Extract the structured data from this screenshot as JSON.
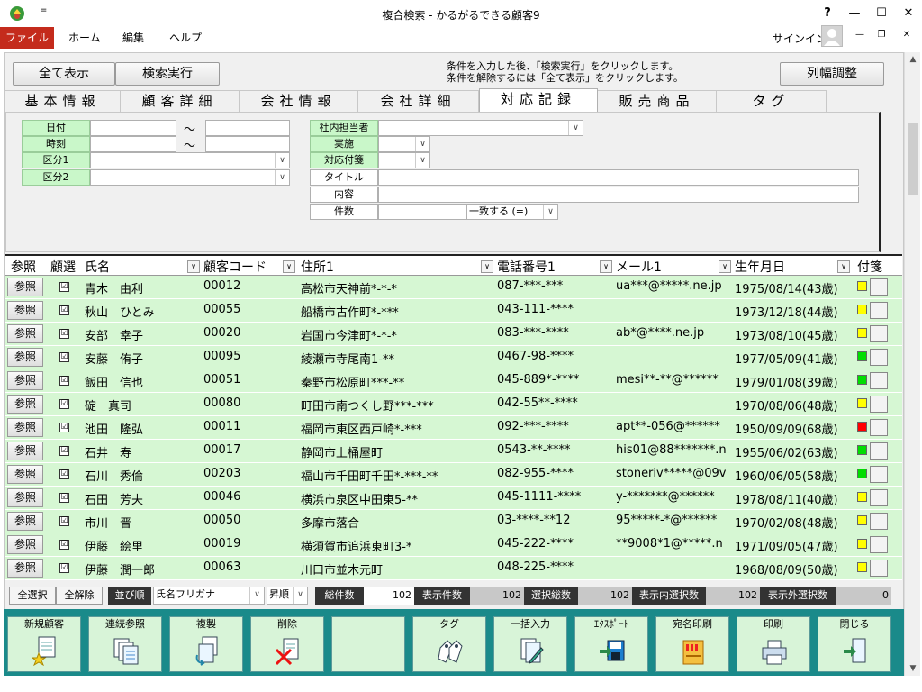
{
  "window": {
    "title": "複合検索 - かるがるできる顧客9",
    "quick_access": "=",
    "help": "?"
  },
  "menu": {
    "file": "ファイル",
    "home": "ホーム",
    "edit": "編集",
    "help": "ヘルプ",
    "signin": "サインイン"
  },
  "toolbar": {
    "show_all": "全て表示",
    "search": "検索実行",
    "hint1": "条件を入力した後、「検索実行」をクリックします。",
    "hint2": "条件を解除するには「全て表示」をクリックします。",
    "column_width": "列幅調整"
  },
  "tabs": [
    "基本情報",
    "顧客詳細",
    "会社情報",
    "会社詳細",
    "対応記録",
    "販売商品",
    "タグ"
  ],
  "active_tab": "対応記録",
  "filters": {
    "date": "日付",
    "time": "時刻",
    "kubun1": "区分1",
    "kubun2": "区分2",
    "tilde": "～",
    "staff": "社内担当者",
    "done": "実施",
    "attach": "対応付箋",
    "title": "タイトル",
    "content": "内容",
    "count": "件数",
    "match_option": "一致する (=)"
  },
  "grid": {
    "headers": {
      "ref": "参照",
      "sel": "顧選",
      "name": "氏名",
      "code": "顧客コード",
      "addr": "住所1",
      "tel": "電話番号1",
      "mail": "メール1",
      "birth": "生年月日",
      "tag": "付箋"
    },
    "ref_label": "参照",
    "check": "☑",
    "rows": [
      {
        "name": "青木　由利",
        "code": "00012",
        "addr": "高松市天神前*-*-*",
        "tel": "087-***-***",
        "mail": "ua***@*****.ne.jp",
        "birth": "1975/08/14(43歳)",
        "tag": "#ffff00"
      },
      {
        "name": "秋山　ひとみ",
        "code": "00055",
        "addr": "船橋市古作町*-***",
        "tel": "043-111-****",
        "mail": "",
        "birth": "1973/12/18(44歳)",
        "tag": "#ffff00"
      },
      {
        "name": "安部　幸子",
        "code": "00020",
        "addr": "岩国市今津町*-*-*",
        "tel": "083-***-****",
        "mail": "ab*@****.ne.jp",
        "birth": "1973/08/10(45歳)",
        "tag": "#ffff00"
      },
      {
        "name": "安藤　侑子",
        "code": "00095",
        "addr": "綾瀬市寺尾南1-**",
        "tel": "0467-98-****",
        "mail": "",
        "birth": "1977/05/09(41歳)",
        "tag": "#00dd00"
      },
      {
        "name": "飯田　信也",
        "code": "00051",
        "addr": "秦野市松原町***-**",
        "tel": "045-889*-****",
        "mail": "mesi**-**@******",
        "birth": "1979/01/08(39歳)",
        "tag": "#00dd00"
      },
      {
        "name": "碇　真司",
        "code": "00080",
        "addr": "町田市南つくし野***-***",
        "tel": "042-55**-****",
        "mail": "",
        "birth": "1970/08/06(48歳)",
        "tag": "#ffff00"
      },
      {
        "name": "池田　隆弘",
        "code": "00011",
        "addr": "福岡市東区西戸崎*-***",
        "tel": "092-***-****",
        "mail": "apt**-056@******",
        "birth": "1950/09/09(68歳)",
        "tag": "#ff0000"
      },
      {
        "name": "石井　寿",
        "code": "00017",
        "addr": "静岡市上桶屋町",
        "tel": "0543-**-****",
        "mail": "his01@88*******.n",
        "birth": "1955/06/02(63歳)",
        "tag": "#00dd00"
      },
      {
        "name": "石川　秀倫",
        "code": "00203",
        "addr": "福山市千田町千田*-***-**",
        "tel": "082-955-****",
        "mail": "stoneriv*****@09v",
        "birth": "1960/06/05(58歳)",
        "tag": "#00dd00"
      },
      {
        "name": "石田　芳夫",
        "code": "00046",
        "addr": "横浜市泉区中田東5-**",
        "tel": "045-1111-****",
        "mail": "y-*******@******",
        "birth": "1978/08/11(40歳)",
        "tag": "#ffff00"
      },
      {
        "name": "市川　晋",
        "code": "00050",
        "addr": "多摩市落合",
        "tel": "03-****-**12",
        "mail": "95*****-*@******",
        "birth": "1970/02/08(48歳)",
        "tag": "#ffff00"
      },
      {
        "name": "伊藤　絵里",
        "code": "00019",
        "addr": "横須賀市追浜東町3-*",
        "tel": "045-222-****",
        "mail": "**9008*1@*****.n",
        "birth": "1971/09/05(47歳)",
        "tag": "#ffff00"
      },
      {
        "name": "伊藤　潤一郎",
        "code": "00063",
        "addr": "川口市並木元町",
        "tel": "048-225-****",
        "mail": "",
        "birth": "1968/08/09(50歳)",
        "tag": "#ffff00"
      }
    ]
  },
  "status": {
    "select_all": "全選択",
    "deselect_all": "全解除",
    "sort": "並び順",
    "sort_field": "氏名フリガナ",
    "sort_order": "昇順",
    "total_label": "総件数",
    "total": "102",
    "shown_label": "表示件数",
    "shown": "102",
    "selected_label": "選択総数",
    "selected": "102",
    "selected_in_label": "表示内選択数",
    "selected_in": "102",
    "selected_out_label": "表示外選択数",
    "selected_out": "0"
  },
  "actions": [
    "新規顧客",
    "連続参照",
    "複製",
    "削除",
    "",
    "タグ",
    "一括入力",
    "ｴｸｽﾎﾟｰﾄ",
    "宛名印刷",
    "印刷",
    "閉じる"
  ]
}
